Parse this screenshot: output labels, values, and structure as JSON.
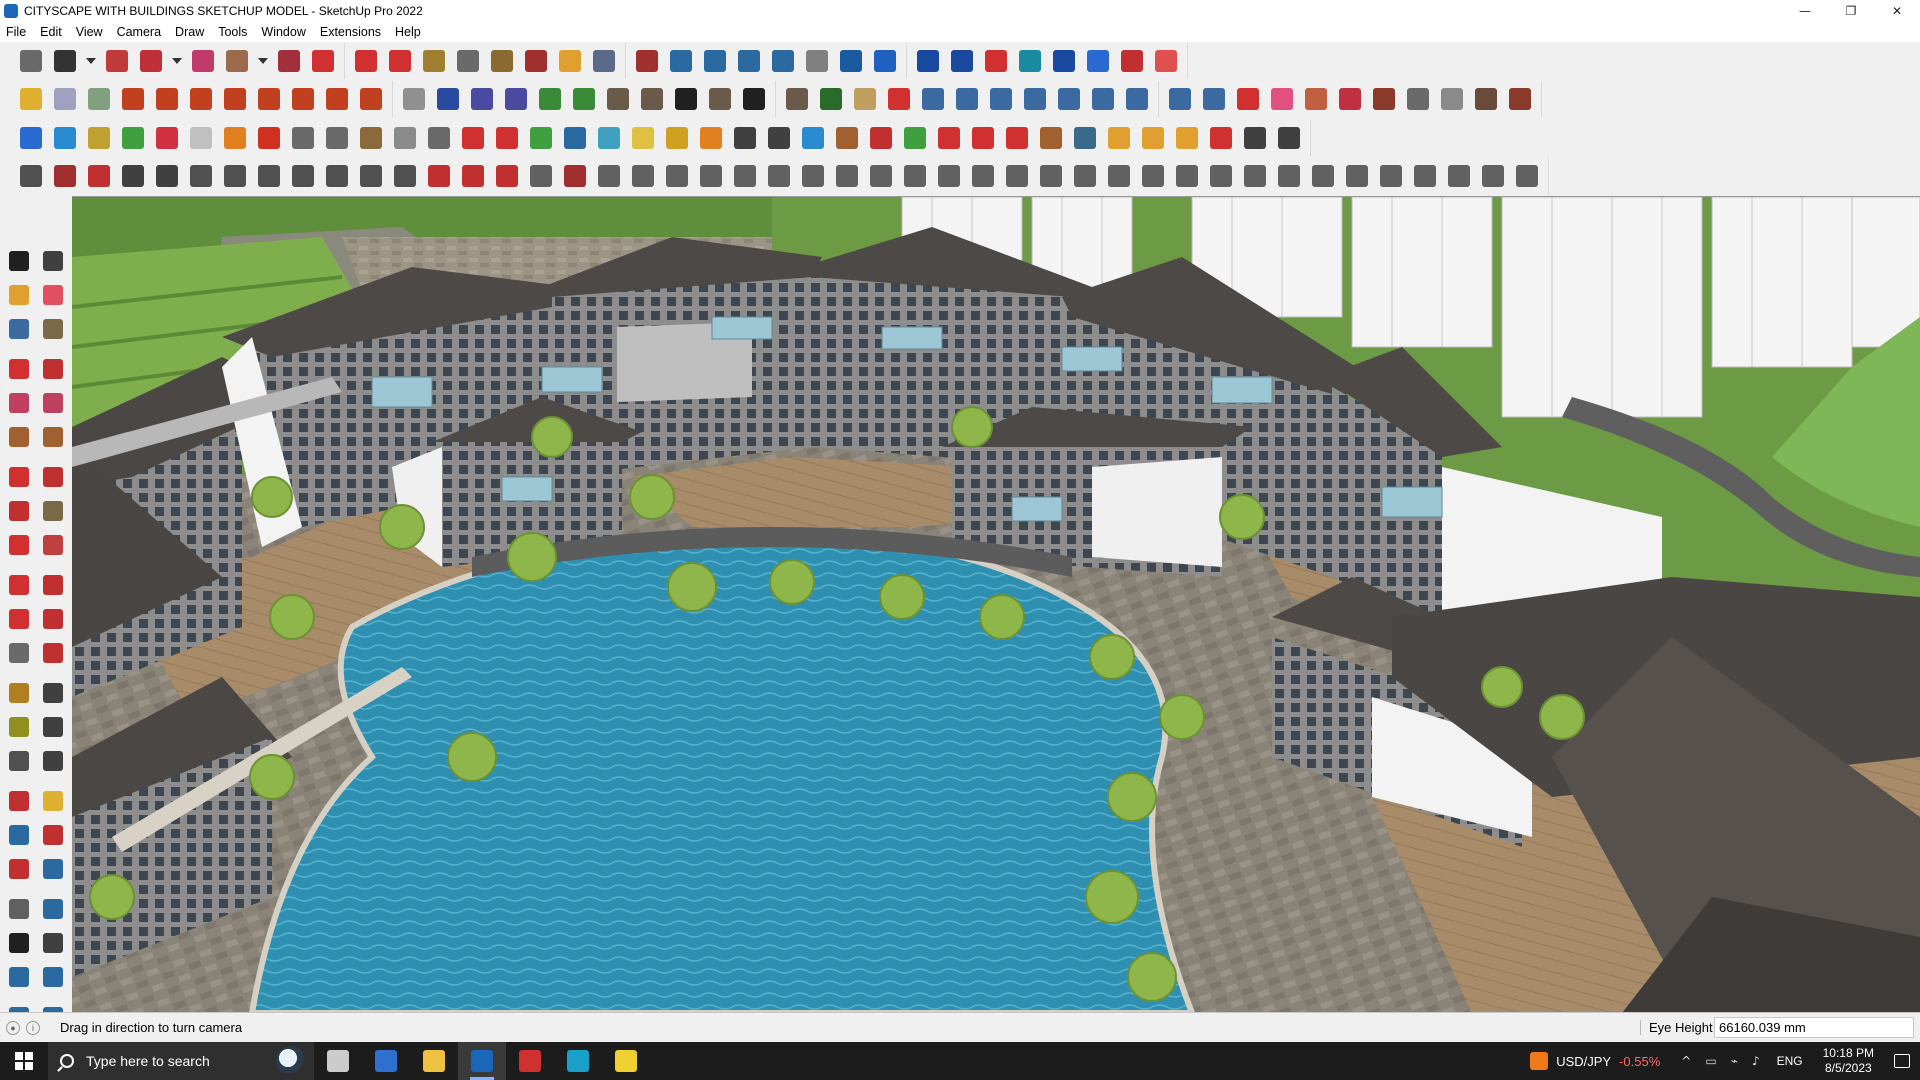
{
  "window": {
    "title": "CITYSCAPE WITH BUILDINGS SKETCHUP MODEL - SketchUp Pro 2022",
    "minimize": "—",
    "restore": "❐",
    "close": "✕"
  },
  "menu": [
    "File",
    "Edit",
    "View",
    "Camera",
    "Draw",
    "Tools",
    "Window",
    "Extensions",
    "Help"
  ],
  "toolbar_colors": {
    "row1": [
      "#6a6a6a",
      "#333333",
      "#c03a3a",
      "#c0303a",
      "#c03a6a",
      "#9a6a4a",
      "#a0303a",
      "#d03030",
      "#d03030",
      "#d03030",
      "#a08030",
      "#6a6a6a",
      "#8a6a30",
      "#a03030",
      "#e0a030",
      "#5a6a8a",
      "#a03030",
      "#2a6aa0",
      "#2a6aa0",
      "#2a6aa0",
      "#2a6aa0",
      "#808080",
      "#1a5aa0",
      "#2060c0",
      "#1a4aa0",
      "#1a4aa0",
      "#d03030",
      "#1a8aa0",
      "#1a4aa0",
      "#2a6ad0",
      "#c03030",
      "#e05050"
    ],
    "row2": [
      "#e0b030",
      "#a0a0c0",
      "#80a080",
      "#c04020",
      "#c04020",
      "#c04020",
      "#c04020",
      "#c04020",
      "#c04020",
      "#c04020",
      "#c04020",
      "#909090",
      "#2a4aa0",
      "#4a4aa0",
      "#4a4aa0",
      "#3a8a3a",
      "#3a8a3a",
      "#6a5a4a",
      "#6a5a4a",
      "#202020",
      "#6a5a4a",
      "#202020",
      "#6a5a4a",
      "#2a6a2a",
      "#c0a060",
      "#d03030",
      "#3a6aa0",
      "#3a6aa0",
      "#3a6aa0",
      "#3a6aa0",
      "#3a6aa0",
      "#3a6aa0",
      "#3a6aa0",
      "#3a6aa0",
      "#3a6aa0",
      "#d03030",
      "#e05080",
      "#c06040",
      "#c03040",
      "#8a3a2a",
      "#6a6a6a",
      "#8a8a8a",
      "#6a4a3a",
      "#8a3a2a"
    ],
    "row3": [
      "#2a6ad0",
      "#2a8ad0",
      "#c0a030",
      "#40a040",
      "#d03040",
      "#c0c0c0",
      "#e08020",
      "#d03020",
      "#6a6a6a",
      "#6a6a6a",
      "#8a6a3a",
      "#8a8a8a",
      "#6a6a6a",
      "#d03030",
      "#d03030",
      "#40a040",
      "#2a6aa0",
      "#40a0c0",
      "#e0c040",
      "#d0a020",
      "#e08020",
      "#404040",
      "#404040",
      "#2a8ad0",
      "#a06030",
      "#c03030",
      "#40a040",
      "#d03030",
      "#d03030",
      "#d03030",
      "#a06030",
      "#3a6a8a",
      "#e0a030",
      "#e0a030",
      "#e0a030",
      "#d03030",
      "#404040",
      "#404040"
    ],
    "row4": [
      "#505050",
      "#a03030",
      "#c03030",
      "#404040",
      "#404040",
      "#505050",
      "#505050",
      "#505050",
      "#505050",
      "#505050",
      "#505050",
      "#505050",
      "#c03030",
      "#c03030",
      "#c03030",
      "#606060",
      "#a03030",
      "#606060",
      "#606060",
      "#606060",
      "#606060",
      "#606060",
      "#606060",
      "#606060",
      "#606060",
      "#606060",
      "#606060",
      "#606060",
      "#606060",
      "#606060",
      "#606060",
      "#606060",
      "#606060",
      "#606060",
      "#606060",
      "#606060",
      "#606060",
      "#606060",
      "#606060",
      "#606060",
      "#606060",
      "#606060",
      "#606060",
      "#606060",
      "#606060"
    ],
    "left": [
      "#202020",
      "#404040",
      "#e0a030",
      "#e05060",
      "#3a6aa0",
      "#7a6a4a",
      "#d03030",
      "#c03030",
      "#c04060",
      "#c04060",
      "#a06030",
      "#a06030",
      "#d03030",
      "#c03030",
      "#c03030",
      "#7a6a4a",
      "#d03030",
      "#c04040",
      "#d03030",
      "#c03030",
      "#d03030",
      "#c03030",
      "#6a6a6a",
      "#c03030",
      "#b08020",
      "#404040",
      "#909020",
      "#404040",
      "#505050",
      "#404040",
      "#c03030",
      "#e0b030",
      "#2a6aa0",
      "#c03030",
      "#c03030",
      "#2a6aa0",
      "#606060",
      "#2a6aa0",
      "#202020",
      "#404040",
      "#2a6aa0",
      "#2a6aa0",
      "#2a6aa0",
      "#2a6aa0"
    ]
  },
  "status": {
    "message": "Drag in direction to turn camera",
    "vcb_label": "Eye Height",
    "vcb_value": "66160.039 mm"
  },
  "taskbar": {
    "search_placeholder": "Type here to search",
    "apps": [
      {
        "name": "task-view",
        "color": "#cccccc"
      },
      {
        "name": "calculator",
        "color": "#2f6fd0"
      },
      {
        "name": "file-explorer",
        "color": "#f0c040"
      },
      {
        "name": "sketchup",
        "color": "#1a66b8"
      },
      {
        "name": "acrobat",
        "color": "#d03030"
      },
      {
        "name": "edge",
        "color": "#1aa0c8"
      },
      {
        "name": "sticky-notes",
        "color": "#f0d030"
      }
    ],
    "ticker_pair": "USD/JPY",
    "ticker_change": "-0.55%",
    "tray_icons": [
      "^",
      "▭",
      "⌁",
      "♪"
    ],
    "language": "ENG",
    "time": "10:18 PM",
    "date": "8/5/2023"
  }
}
